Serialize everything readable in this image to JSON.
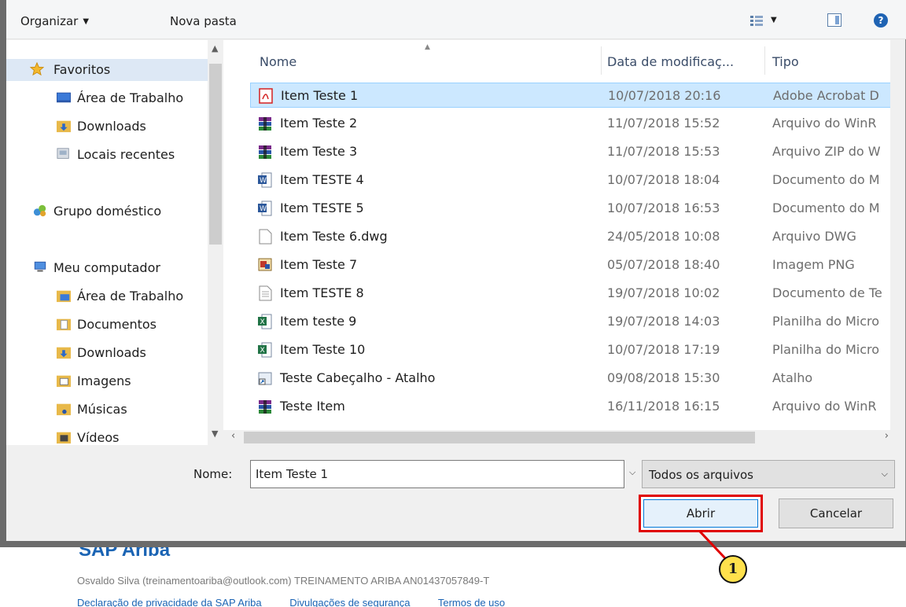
{
  "toolbar": {
    "organize_label": "Organizar",
    "newfolder_label": "Nova pasta"
  },
  "nav": {
    "favorites": "Favoritos",
    "fav_items": [
      "Área de Trabalho",
      "Downloads",
      "Locais recentes"
    ],
    "homegroup": "Grupo doméstico",
    "computer": "Meu computador",
    "comp_items": [
      "Área de Trabalho",
      "Documentos",
      "Downloads",
      "Imagens",
      "Músicas",
      "Vídeos"
    ]
  },
  "list": {
    "headers": {
      "name": "Nome",
      "date": "Data de modificaç...",
      "type": "Tipo"
    },
    "files": [
      {
        "name": "Item Teste 1",
        "date": "10/07/2018 20:16",
        "type": "Adobe Acrobat D",
        "icon": "pdf-icon"
      },
      {
        "name": "Item Teste 2",
        "date": "11/07/2018 15:52",
        "type": "Arquivo do WinR",
        "icon": "winrar-icon"
      },
      {
        "name": "Item Teste 3",
        "date": "11/07/2018 15:53",
        "type": "Arquivo ZIP do W",
        "icon": "winrar-icon"
      },
      {
        "name": "Item TESTE 4",
        "date": "10/07/2018 18:04",
        "type": "Documento do M",
        "icon": "word-icon"
      },
      {
        "name": "Item TESTE 5",
        "date": "10/07/2018 16:53",
        "type": "Documento do M",
        "icon": "word-icon"
      },
      {
        "name": "Item Teste 6.dwg",
        "date": "24/05/2018 10:08",
        "type": "Arquivo DWG",
        "icon": "blank-file-icon"
      },
      {
        "name": "Item Teste 7",
        "date": "05/07/2018 18:40",
        "type": "Imagem PNG",
        "icon": "image-icon"
      },
      {
        "name": "Item TESTE 8",
        "date": "19/07/2018 10:02",
        "type": "Documento de Te",
        "icon": "text-file-icon"
      },
      {
        "name": "Item teste 9",
        "date": "19/07/2018 14:03",
        "type": "Planilha do Micro",
        "icon": "excel-icon"
      },
      {
        "name": "Item Teste 10",
        "date": "10/07/2018 17:19",
        "type": "Planilha do Micro",
        "icon": "excel-icon"
      },
      {
        "name": "Teste Cabeçalho - Atalho",
        "date": "09/08/2018 15:30",
        "type": "Atalho",
        "icon": "shortcut-icon"
      },
      {
        "name": "Teste Item",
        "date": "16/11/2018 16:15",
        "type": "Arquivo do WinR",
        "icon": "winrar-icon"
      }
    ]
  },
  "filename": {
    "label": "Nome:",
    "value": "Item Teste 1"
  },
  "filter": {
    "value": "Todos os arquivos"
  },
  "buttons": {
    "open": "Abrir",
    "cancel": "Cancelar"
  },
  "background_page": {
    "logo": "SAP Ariba",
    "user_line": "Osvaldo Silva (treinamentoariba@outlook.com)   TREINAMENTO ARIBA   AN01437057849-T",
    "links": [
      "Declaração de privacidade da SAP Ariba",
      "Divulgações de segurança",
      "Termos de uso"
    ]
  },
  "callout": {
    "number": "1"
  },
  "colors": {
    "selection": "#cce8ff",
    "highlight_border": "#e00000",
    "callout_fill": "#ffe14c",
    "link": "#1b64b4"
  }
}
